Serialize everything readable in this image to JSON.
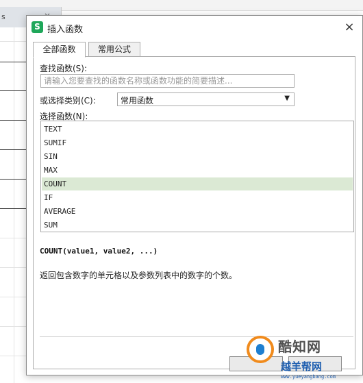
{
  "sheet": {
    "tab_label": "s",
    "tab_close": "×"
  },
  "dialog": {
    "title": "插入函数",
    "app_icon": "S",
    "close_icon": "×",
    "tabs": [
      {
        "label": "全部函数",
        "active": true
      },
      {
        "label": "常用公式",
        "active": false
      }
    ],
    "search": {
      "label": "查找函数(S):",
      "placeholder": "请输入您要查找的函数名称或函数功能的简要描述..."
    },
    "category": {
      "label": "或选择类别(C):",
      "value": "常用函数",
      "arrow_icon": "▼"
    },
    "functions": {
      "label": "选择函数(N):",
      "items": [
        "TEXT",
        "SUMIF",
        "SIN",
        "MAX",
        "COUNT",
        "IF",
        "AVERAGE",
        "SUM"
      ],
      "selected": "COUNT"
    },
    "signature": "COUNT(value1, value2, ...)",
    "description": "返回包含数字的单元格以及参数列表中的数字的个数。",
    "ok_label": "",
    "cancel_label": ""
  },
  "watermark": {
    "brand": "酷知网",
    "brand2": "越羊帮网",
    "url": "www.yueyangbang.com"
  },
  "colors": {
    "selected_row": "#dbe9d4",
    "app_icon": "#1fa75a",
    "watermark_orange": "#f08b1d",
    "watermark_blue": "#1f5fb0"
  }
}
